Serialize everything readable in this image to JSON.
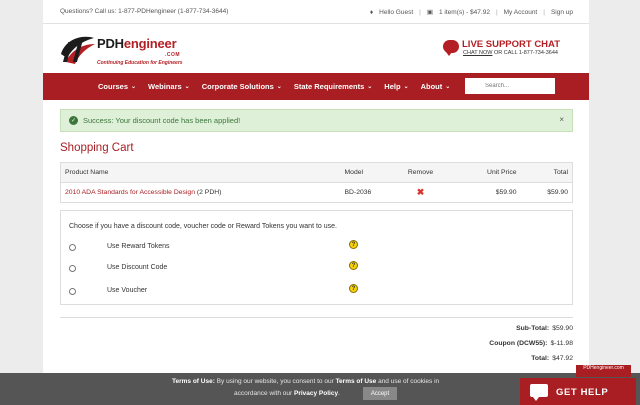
{
  "topbar": {
    "call": "Questions? Call us: 1-877-PDHengineer (1-877-734-3644)",
    "greeting": "Hello Guest",
    "cart": "1 item(s) - $47.92",
    "account": "My Account",
    "signup": "Sign up"
  },
  "logo": {
    "brand_a": "PDH",
    "brand_b": "engineer",
    "com": ".COM",
    "tagline": "Continuing Education for Engineers"
  },
  "support": {
    "title": "LIVE SUPPORT CHAT",
    "chat_now": "CHAT NOW",
    "call": " OR CALL 1-877-734-3644"
  },
  "nav": {
    "items": [
      {
        "label": "Courses"
      },
      {
        "label": "Webinars"
      },
      {
        "label": "Corporate Solutions"
      },
      {
        "label": "State Requirements"
      },
      {
        "label": "Help"
      },
      {
        "label": "About"
      }
    ],
    "search_placeholder": "Search..."
  },
  "alert": {
    "message": "Success: Your discount code has been applied!",
    "close": "×"
  },
  "cart": {
    "title": "Shopping Cart",
    "headers": {
      "product": "Product Name",
      "model": "Model",
      "remove": "Remove",
      "unit_price": "Unit Price",
      "total": "Total"
    },
    "rows": [
      {
        "product": "2010 ADA Standards for Accessible Design",
        "hours": " (2 PDH)",
        "model": "BD-2036",
        "unit_price": "$59.90",
        "total": "$59.90"
      }
    ]
  },
  "discount": {
    "intro": "Choose if you have a discount code, voucher code or Reward Tokens you want to use.",
    "options": [
      {
        "label": "Use Reward Tokens"
      },
      {
        "label": "Use Discount Code"
      },
      {
        "label": "Use Voucher"
      }
    ]
  },
  "totals": {
    "subtotal_label": "Sub-Total:",
    "subtotal": "$59.90",
    "coupon_label": "Coupon (DCW55):",
    "coupon": "$-11.98",
    "total_label": "Total:",
    "total": "$47.92"
  },
  "cookie": {
    "terms_label": "Terms of Use:",
    "text1": " By using our website, you consent to our ",
    "terms_link": "Terms of Use",
    "text2": " and use of cookies in",
    "text3": "accordance with our ",
    "privacy_link": "Privacy Policy",
    "text4": ".",
    "accept": "Accept"
  },
  "help_widget": {
    "label": "GET HELP",
    "badge": "PDHengineer.com"
  },
  "colors": {
    "brand_red": "#a81e22",
    "success_bg": "#dff0d8",
    "success_text": "#3c763d"
  }
}
